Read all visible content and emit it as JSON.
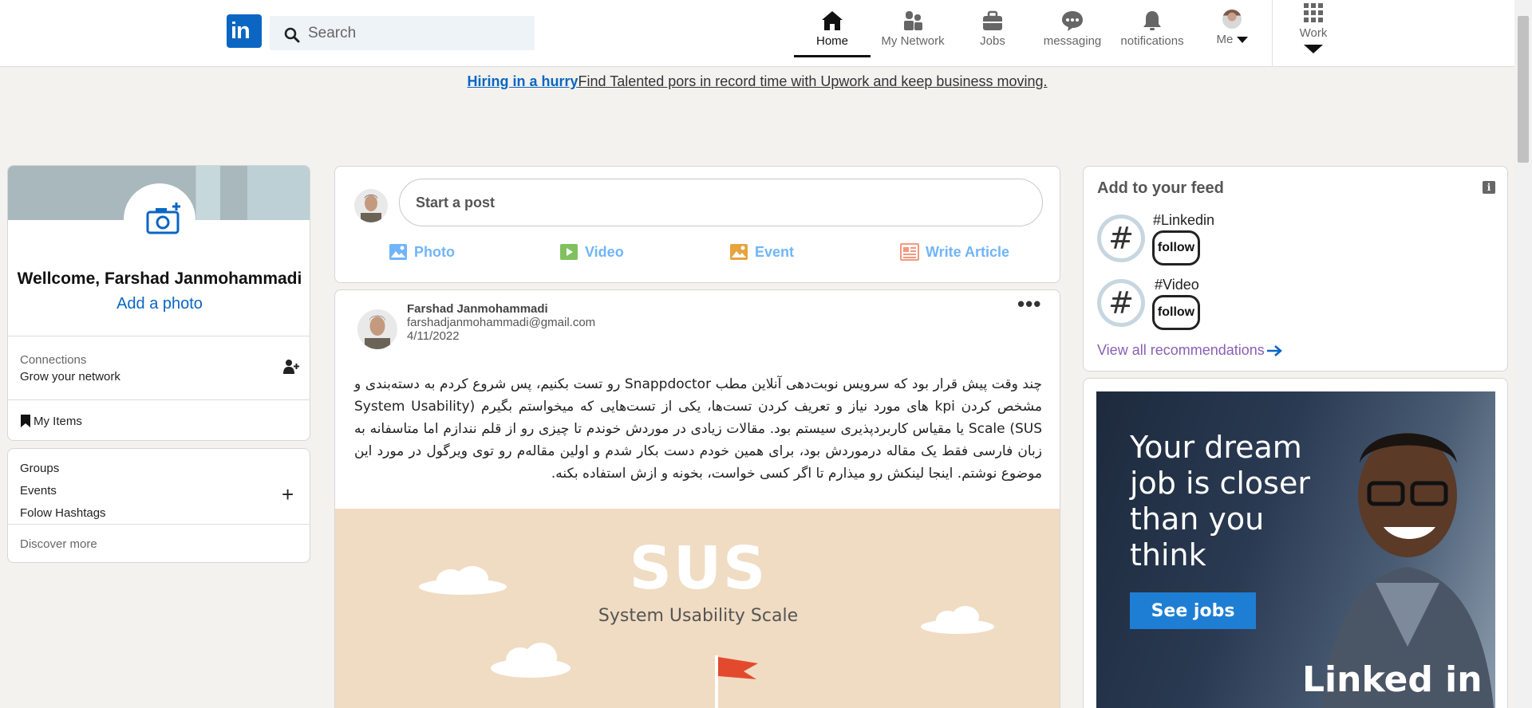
{
  "header": {
    "logo_text": "in",
    "search_placeholder": "Search",
    "nav": {
      "home": "Home",
      "network": "My Network",
      "jobs": "Jobs",
      "messaging": "messaging",
      "notifications": "notifications",
      "me": "Me",
      "work": "Work"
    }
  },
  "promo": {
    "link": "Hiring in a hurry",
    "text": "Find Talented pors in record time with Upwork and keep business moving."
  },
  "profile": {
    "welcome": "Wellcome, Farshad Janmohammadi",
    "add_photo": "Add a photo",
    "connections_label": "Connections",
    "connections_sub": "Grow your network",
    "my_items": "My Items"
  },
  "groups": {
    "groups": "Groups",
    "events": "Events",
    "hashtags": "Folow Hashtags",
    "discover": "Discover more"
  },
  "share": {
    "placeholder": "Start a post",
    "photo": "Photo",
    "video": "Video",
    "event": "Event",
    "article": "Write Article"
  },
  "post": {
    "author": "Farshad Janmohammadi",
    "email": "farshadjanmohammadi@gmail.com",
    "date": "4/11/2022",
    "menu": "•••",
    "body": "چند وقت پیش قرار بود که سرویس نوبت‌دهی آنلاین مطب Snappdoctor رو تست بکنیم، پس شروع کردم به دسته‌بندی و مشخص کردن kpi های مورد نیاز و تعریف کردن تست‌ها، یکی از تست‌هایی که میخواستم بگیرم (System Usability Scale (SUS یا مقیاس کاربردپذیری سیستم بود. مقالات زیادی در موردش خوندم تا چیزی رو از قلم نندازم اما متاسفانه به زبان فارسی فقط یک مقاله درموردش بود، برای همین خودم دست بکار شدم و اولین مقاله‌م رو توی ویرگول در مورد این موضوع نوشتم. اینجا لینکش رو میذارم تا اگر کسی خواست، بخونه و ازش استفاده بکنه.",
    "image_title": "SUS",
    "image_subtitle": "System Usability Scale"
  },
  "feed": {
    "title": "Add to your feed",
    "info": "i",
    "items": [
      {
        "name": "#Linkedin",
        "follow": "follow"
      },
      {
        "name": "#Video",
        "follow": "follow"
      }
    ],
    "view_all": "View all recommendations"
  },
  "ad": {
    "headline": "Your dream job is closer than you think",
    "button": "See jobs",
    "brand": "Linked in"
  },
  "colors": {
    "brand": "#0a66c2",
    "action": "#70b5f9",
    "link_purple": "#8a5fb5"
  }
}
